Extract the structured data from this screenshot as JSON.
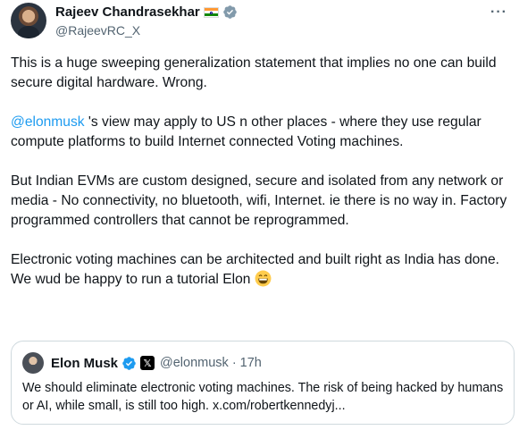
{
  "author": {
    "name": "Rajeev Chandrasekhar",
    "handle": "@RajeevRC_X"
  },
  "menu": {
    "more_label": "···"
  },
  "tweet": {
    "p1": "This is a huge sweeping generalization statement that implies no one can build  secure digital hardware. Wrong.",
    "p2_mention": "@elonmusk",
    "p2_rest": " 's view may apply to US n other places - where they use regular compute platforms to build Internet connected Voting machines.",
    "p3": "But Indian EVMs are custom designed,  secure and isolated from any network or media - No connectivity, no bluetooth, wifi, Internet. ie there is no way in. Factory programmed controllers that cannot be reprogrammed.",
    "p4": "Electronic voting machines can be architected and built right as India has done.  We wud be happy to run a tutorial Elon "
  },
  "quoted": {
    "name": "Elon Musk",
    "affiliate_badge": "𝕏",
    "handle_time": "@elonmusk · 17h",
    "text": "We should eliminate electronic voting machines. The risk of being hacked by humans or AI, while small, is still too high. x.com/robertkennedyj..."
  },
  "colors": {
    "link": "#1d9bf0",
    "verified_blue": "#1d9bf0",
    "gov_grey": "#829aab",
    "secondary_text": "#536471",
    "border": "#cfd9de"
  },
  "icons": [
    "avatar",
    "india-flag-icon",
    "government-verified-icon",
    "more-icon",
    "grinning-emoji-icon",
    "verified-icon",
    "x-affiliate-icon"
  ]
}
